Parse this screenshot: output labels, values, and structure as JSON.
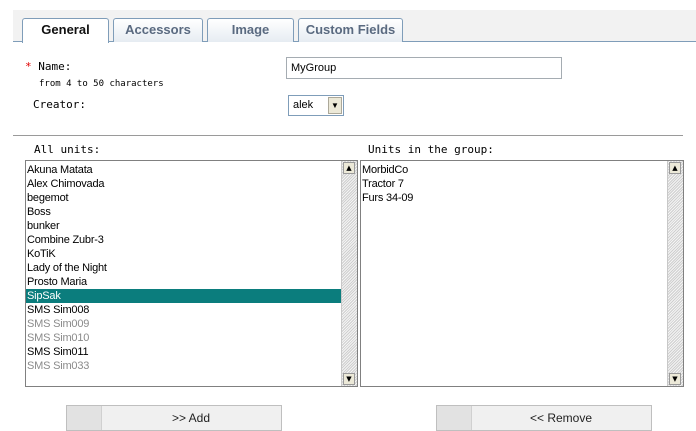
{
  "tabs": [
    {
      "label": "General",
      "active": true
    },
    {
      "label": "Accessors",
      "active": false
    },
    {
      "label": "Image",
      "active": false
    },
    {
      "label": "Custom Fields",
      "active": false
    }
  ],
  "form": {
    "required_mark": "*",
    "name_label": " Name:",
    "name_hint": "from 4 to 50 characters",
    "name_value": "MyGroup",
    "creator_label": "Creator:",
    "creator_value": "alek"
  },
  "all_units": {
    "label": "All units:",
    "items": [
      {
        "text": "Akuna Matata",
        "state": "normal"
      },
      {
        "text": "Alex Chimovada",
        "state": "normal"
      },
      {
        "text": "begemot",
        "state": "normal"
      },
      {
        "text": "Boss",
        "state": "normal"
      },
      {
        "text": "bunker",
        "state": "normal"
      },
      {
        "text": "Combine Zubr-3",
        "state": "normal"
      },
      {
        "text": "KoTiK",
        "state": "normal"
      },
      {
        "text": "Lady of the Night",
        "state": "normal"
      },
      {
        "text": "Prosto Maria",
        "state": "normal"
      },
      {
        "text": "SipSak",
        "state": "selected"
      },
      {
        "text": "SMS Sim008",
        "state": "normal"
      },
      {
        "text": "SMS Sim009",
        "state": "dim"
      },
      {
        "text": "SMS Sim010",
        "state": "dim"
      },
      {
        "text": "SMS Sim011",
        "state": "normal"
      },
      {
        "text": "SMS Sim033",
        "state": "dim"
      }
    ]
  },
  "group_units": {
    "label": "Units in the group:",
    "items": [
      {
        "text": "MorbidCo",
        "state": "normal"
      },
      {
        "text": "Tractor 7",
        "state": "normal"
      },
      {
        "text": "Furs 34-09",
        "state": "normal"
      }
    ]
  },
  "buttons": {
    "add_label": ">> Add",
    "remove_label": "<< Remove"
  },
  "icons": {
    "scroll_up": "up-arrow-icon",
    "scroll_down": "down-arrow-icon",
    "dropdown": "chevron-down-icon"
  },
  "colors": {
    "selection": "#0b7d7d",
    "required": "#e00000",
    "dim_text": "#8a8a8a"
  }
}
